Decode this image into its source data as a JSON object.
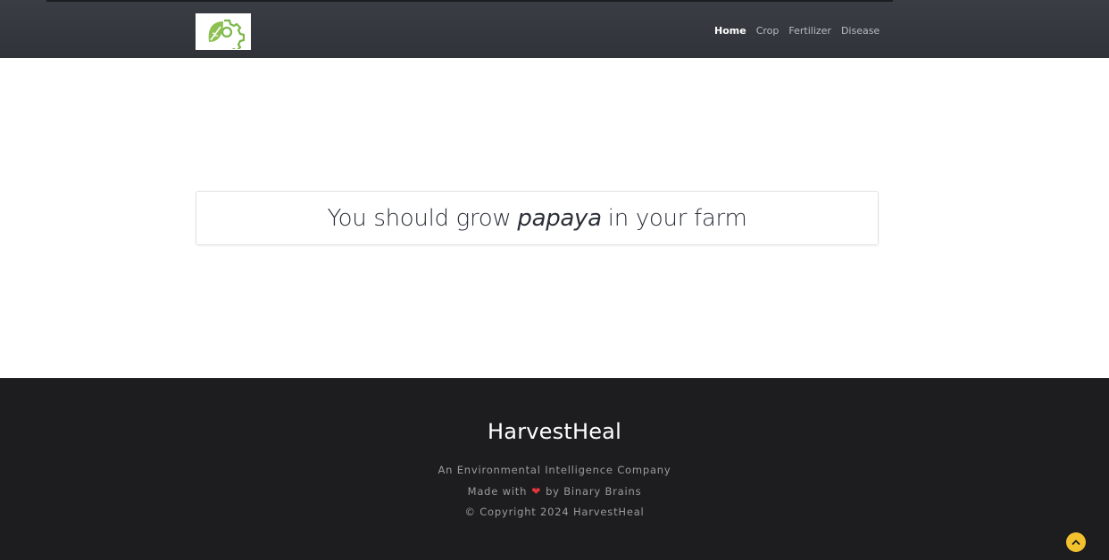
{
  "nav": {
    "logo_icon": "leaf-gear-icon",
    "items": [
      {
        "label": "Home"
      },
      {
        "label": "Crop"
      },
      {
        "label": "Fertilizer"
      },
      {
        "label": "Disease"
      }
    ],
    "active": "Home"
  },
  "result": {
    "prefix": "You should grow",
    "crop": "papaya",
    "suffix": "in your farm"
  },
  "footer": {
    "brand": "HarvestHeal",
    "tagline": "An Environmental Intelligence Company",
    "made_with_prefix": "Made with",
    "made_with_icon": "heart-icon",
    "made_with_suffix": "by Binary Brains",
    "copyright": "© Copyright 2024 HarvestHeal"
  },
  "scroll_top": {
    "icon": "chevron-up-icon"
  },
  "colors": {
    "navbar": "#32363c",
    "footer": "#1d1c1e",
    "accent": "#f2c12e",
    "logo_green": "#7ab648",
    "heart": "#e0363b"
  }
}
